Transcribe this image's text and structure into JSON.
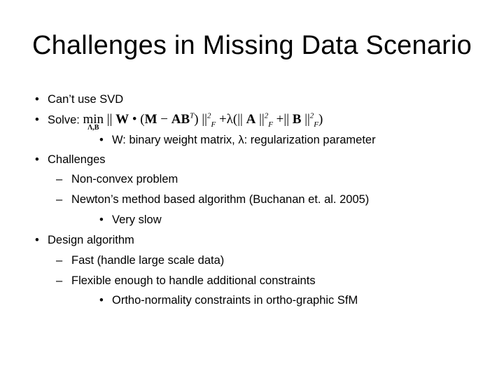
{
  "slide": {
    "title": "Challenges in Missing Data Scenario",
    "items": [
      {
        "level": 1,
        "marker": "•",
        "text": "Can’t use SVD"
      },
      {
        "level": 1,
        "marker": "•",
        "text": "Solve:"
      },
      {
        "level": 3,
        "marker": "•",
        "text": "W: binary weight matrix,  λ: regularization parameter"
      },
      {
        "level": 1,
        "marker": "•",
        "text": "Challenges"
      },
      {
        "level": 2,
        "marker": "–",
        "text": "Non-convex problem"
      },
      {
        "level": 2,
        "marker": "–",
        "text": "Newton’s method based algorithm (Buchanan et. al. 2005)"
      },
      {
        "level": 3,
        "marker": "•",
        "text": "Very slow"
      },
      {
        "level": 1,
        "marker": "•",
        "text": "Design algorithm"
      },
      {
        "level": 2,
        "marker": "–",
        "text": "Fast (handle large scale data)"
      },
      {
        "level": 2,
        "marker": "–",
        "text": "Flexible enough to handle additional constraints"
      },
      {
        "level": 3,
        "marker": "•",
        "text": "Ortho-normality constraints in ortho-graphic SfM"
      }
    ],
    "formula": {
      "min": "min",
      "min_sub": "Λ,B",
      "part1": "|| ",
      "W": "W",
      "dot": " • (",
      "M": "M",
      "minus": " − ",
      "AB": "AB",
      "T": "T",
      "close1": ") ||",
      "sq1": "2",
      "F1": "F",
      "plus_lambda": " +λ(|| ",
      "A": "A",
      "norm2": " ||",
      "sq2": "2",
      "F2": "F",
      "plus": " +|| ",
      "B": "B",
      "norm3": " ||",
      "sq3": "2",
      "F3": "F",
      "close2": ")"
    }
  }
}
